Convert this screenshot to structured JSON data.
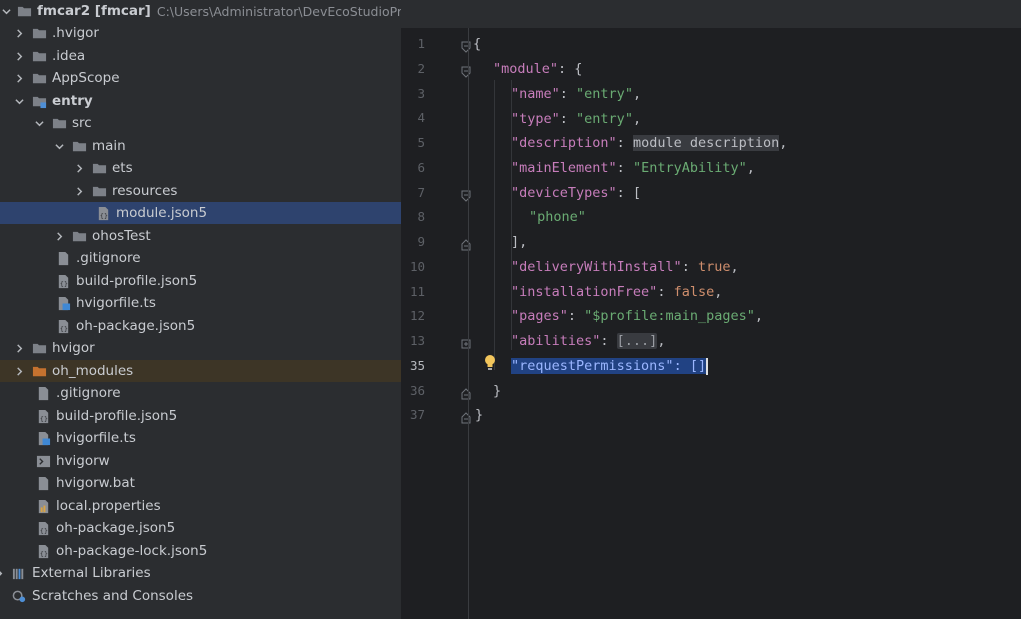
{
  "project": {
    "root_name": "fmcar2 [fmcar]",
    "root_path": "C:\\Users\\Administrator\\DevEcoStudioPro",
    "items": [
      {
        "label": ".hvigor"
      },
      {
        "label": ".idea"
      },
      {
        "label": "AppScope"
      },
      {
        "label": "entry"
      },
      {
        "label": "src"
      },
      {
        "label": "main"
      },
      {
        "label": "ets"
      },
      {
        "label": "resources"
      },
      {
        "label": "module.json5"
      },
      {
        "label": "ohosTest"
      },
      {
        "label": ".gitignore"
      },
      {
        "label": "build-profile.json5"
      },
      {
        "label": "hvigorfile.ts"
      },
      {
        "label": "oh-package.json5"
      },
      {
        "label": "hvigor"
      },
      {
        "label": "oh_modules"
      },
      {
        "label": ".gitignore"
      },
      {
        "label": "build-profile.json5"
      },
      {
        "label": "hvigorfile.ts"
      },
      {
        "label": "hvigorw"
      },
      {
        "label": "hvigorw.bat"
      },
      {
        "label": "local.properties"
      },
      {
        "label": "oh-package.json5"
      },
      {
        "label": "oh-package-lock.json5"
      },
      {
        "label": "External Libraries"
      },
      {
        "label": "Scratches and Consoles"
      }
    ]
  },
  "editor": {
    "line_numbers": [
      "1",
      "2",
      "3",
      "4",
      "5",
      "6",
      "7",
      "8",
      "9",
      "10",
      "11",
      "12",
      "13",
      "35",
      "36",
      "37"
    ],
    "current_line": "35",
    "lines": {
      "l1": {
        "t0": "{"
      },
      "l2": {
        "t0": "\"module\"",
        "t1": ": {"
      },
      "l3": {
        "t0": "\"name\"",
        "t1": ": ",
        "t2": "\"entry\"",
        "t3": ","
      },
      "l4": {
        "t0": "\"type\"",
        "t1": ": ",
        "t2": "\"entry\"",
        "t3": ","
      },
      "l5": {
        "t0": "\"description\"",
        "t1": ": ",
        "t2": "module description",
        "t3": ","
      },
      "l6": {
        "t0": "\"mainElement\"",
        "t1": ": ",
        "t2": "\"EntryAbility\"",
        "t3": ","
      },
      "l7": {
        "t0": "\"deviceTypes\"",
        "t1": ": ["
      },
      "l8": {
        "t0": "\"phone\""
      },
      "l9": {
        "t0": "],"
      },
      "l10": {
        "t0": "\"deliveryWithInstall\"",
        "t1": ": ",
        "t2": "true",
        "t3": ","
      },
      "l11": {
        "t0": "\"installationFree\"",
        "t1": ": ",
        "t2": "false",
        "t3": ","
      },
      "l12": {
        "t0": "\"pages\"",
        "t1": ": ",
        "t2": "\"$profile:main_pages\"",
        "t3": ","
      },
      "l13": {
        "t0": "\"abilities\"",
        "t1": ": ",
        "t2": "[...]",
        "t3": ","
      },
      "l35": {
        "t0": "\"requestPermissions\"",
        "t1": ": []"
      },
      "l36": {
        "t0": "}"
      },
      "l37": {
        "t0": "}"
      }
    }
  },
  "colors": {
    "selection": "#214283",
    "keyword_purple": "#c77dbb",
    "string_green": "#6aab73",
    "boolean_orange": "#cf8e6d",
    "tree_selected": "#2e436e"
  }
}
